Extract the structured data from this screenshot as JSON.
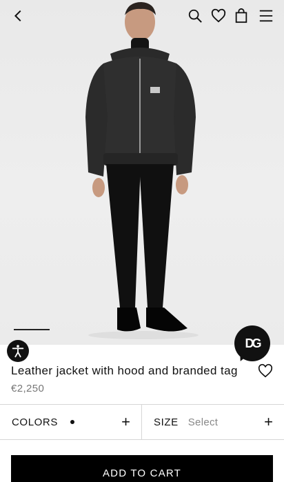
{
  "header": {
    "icons": [
      "back-arrow-icon",
      "search-icon",
      "heart-icon",
      "shopping-bag-icon",
      "hamburger-menu-icon"
    ]
  },
  "product": {
    "title": "Leather jacket with hood and branded tag",
    "price": "€2,250",
    "image_alt_icon": "model-wearing-leather-jacket"
  },
  "badge": {
    "text": "DG"
  },
  "selectors": {
    "colors_label": "COLORS",
    "size_label": "SIZE",
    "size_value": "Select",
    "plus": "+"
  },
  "cart": {
    "label": "ADD TO CART"
  },
  "colors": {
    "accent": "#000000",
    "muted": "#777777",
    "background": "#ececec"
  }
}
